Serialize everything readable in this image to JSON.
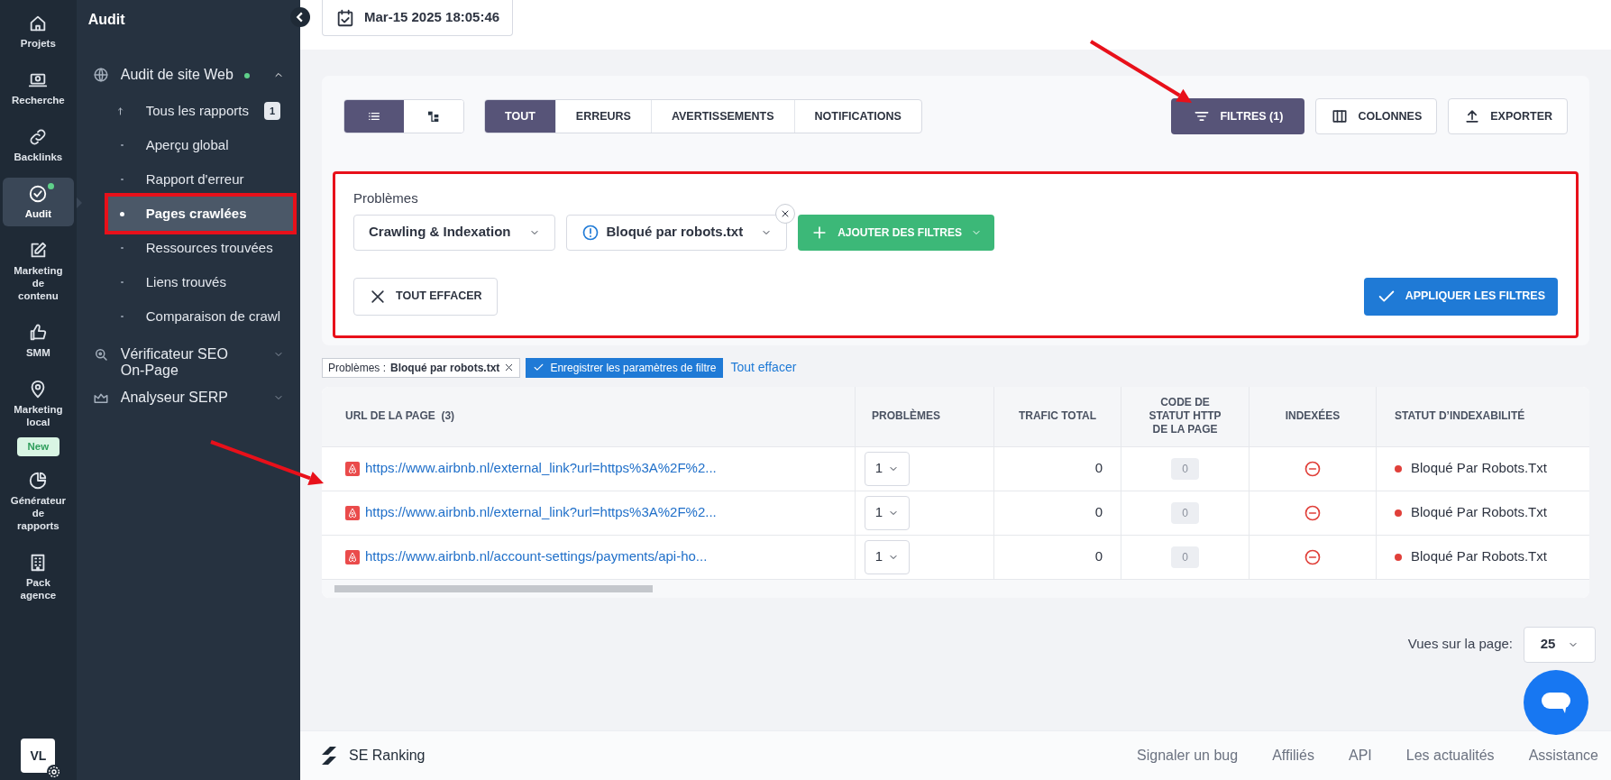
{
  "rail": [
    {
      "label": "Projets",
      "selected": false,
      "dot": false
    },
    {
      "label": "Recherche",
      "selected": false,
      "dot": false
    },
    {
      "label": "Backlinks",
      "selected": false,
      "dot": false
    },
    {
      "label": "Audit",
      "selected": true,
      "dot": true
    },
    {
      "label": "Marketing de contenu",
      "selected": false,
      "dot": false
    },
    {
      "label": "SMM",
      "selected": false,
      "dot": false
    },
    {
      "label": "Marketing local",
      "selected": false,
      "dot": false,
      "badge": "New"
    },
    {
      "label": "Générateur de rapports",
      "selected": false,
      "dot": false
    },
    {
      "label": "Pack agence",
      "selected": false,
      "dot": false
    }
  ],
  "user": {
    "initials": "VL"
  },
  "sidebar": {
    "title": "Audit",
    "sections": [
      {
        "label": "Audit de site Web",
        "expanded": true,
        "dot": true,
        "children": [
          {
            "label": "Tous les rapports",
            "kind": "back",
            "count": "1",
            "selected": false,
            "highlighted": false
          },
          {
            "label": "Aperçu global",
            "kind": "page",
            "selected": false,
            "highlighted": false
          },
          {
            "label": "Rapport d'erreur",
            "kind": "page",
            "selected": false,
            "highlighted": false
          },
          {
            "label": "Pages crawlées",
            "kind": "page",
            "selected": true,
            "highlighted": true
          },
          {
            "label": "Ressources trouvées",
            "kind": "page",
            "selected": false,
            "highlighted": false
          },
          {
            "label": "Liens trouvés",
            "kind": "page",
            "selected": false,
            "highlighted": false
          },
          {
            "label": "Comparaison de crawl",
            "kind": "page",
            "selected": false,
            "highlighted": false
          }
        ]
      },
      {
        "label": "Vérificateur SEO On-Page",
        "expanded": false,
        "dot": false
      },
      {
        "label": "Analyseur SERP",
        "expanded": false,
        "dot": false
      }
    ]
  },
  "date": "Mar-15 2025 18:05:46",
  "view_toggle": [
    {
      "kind": "list",
      "selected": true
    },
    {
      "kind": "tree",
      "selected": false
    }
  ],
  "tabs": [
    {
      "label": "TOUT",
      "selected": true
    },
    {
      "label": "ERREURS",
      "selected": false
    },
    {
      "label": "AVERTISSEMENTS",
      "selected": false
    },
    {
      "label": "NOTIFICATIONS",
      "selected": false
    }
  ],
  "actions": [
    {
      "label": "FILTRES (1)",
      "kind": "filter",
      "selected": true,
      "pointer_arrow": true
    },
    {
      "label": "COLONNES",
      "kind": "columns",
      "selected": false,
      "pointer_arrow": false
    },
    {
      "label": "EXPORTER",
      "kind": "export",
      "selected": false,
      "pointer_arrow": false
    }
  ],
  "filters": {
    "highlighted": true,
    "label": "Problèmes",
    "selects": [
      {
        "value": "Crawling & Indexation",
        "removable": false,
        "kind": "plain"
      },
      {
        "value": "Bloqué par robots.txt",
        "removable": true,
        "kind": "warning"
      }
    ],
    "add_button": "AJOUTER DES FILTRES",
    "clear_button": "TOUT EFFACER",
    "apply_button": "APPLIQUER LES FILTRES"
  },
  "active_filters": {
    "tag_label": "Problèmes :",
    "tag_value": "Bloqué par robots.txt",
    "save_button": "Enregistrer les paramètres de filtre",
    "clear_link": "Tout effacer"
  },
  "table": {
    "pointer_arrow": true,
    "columns": [
      {
        "label": "URL DE LA PAGE",
        "count": "(3)"
      },
      {
        "label": "PROBLÈMES"
      },
      {
        "label": "TRAFIC TOTAL"
      },
      {
        "label": "CODE DE STATUT HTTP DE LA PAGE"
      },
      {
        "label": "INDEXÉES"
      },
      {
        "label": "STATUT D’INDEXABILITÉ"
      }
    ],
    "rows": [
      {
        "url": "https://www.airbnb.nl/external_link?url=https%3A%2F%2...",
        "problems": "1",
        "traffic": "0",
        "http_code": "0",
        "indexed": false,
        "status": "Bloqué Par Robots.Txt",
        "color": "#e0403a"
      },
      {
        "url": "https://www.airbnb.nl/external_link?url=https%3A%2F%2...",
        "problems": "1",
        "traffic": "0",
        "http_code": "0",
        "indexed": false,
        "status": "Bloqué Par Robots.Txt",
        "color": "#e0403a"
      },
      {
        "url": "https://www.airbnb.nl/account-settings/payments/api-ho...",
        "problems": "1",
        "traffic": "0",
        "http_code": "0",
        "indexed": false,
        "status": "Bloqué Par Robots.Txt",
        "color": "#e0403a"
      }
    ]
  },
  "pagination": {
    "label": "Vues sur la page:",
    "value": "25"
  },
  "footer": {
    "brand": "SE Ranking",
    "links": [
      "Signaler un bug",
      "Affiliés",
      "API",
      "Les actualités",
      "Assistance"
    ]
  }
}
